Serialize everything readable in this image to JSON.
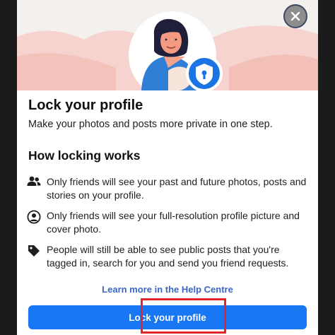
{
  "dialog": {
    "title": "Lock your profile",
    "subtitle": "Make your photos and posts more private in one step.",
    "close_icon": "close-icon"
  },
  "how_it_works": {
    "heading": "How locking works",
    "items": [
      {
        "icon": "people-icon",
        "text": "Only friends will see your past and future photos, posts and stories on your profile."
      },
      {
        "icon": "profile-icon",
        "text": "Only friends will see your full-resolution profile picture and cover photo."
      },
      {
        "icon": "tag-icon",
        "text": "People will still be able to see public posts that you're tagged in, search for you and send you friend requests."
      }
    ]
  },
  "help_link": "Learn more in the Help Centre",
  "lock_button": "Lock your profile",
  "colors": {
    "accent": "#1877f2",
    "link": "#3a66c4",
    "highlight": "#e0262b"
  }
}
